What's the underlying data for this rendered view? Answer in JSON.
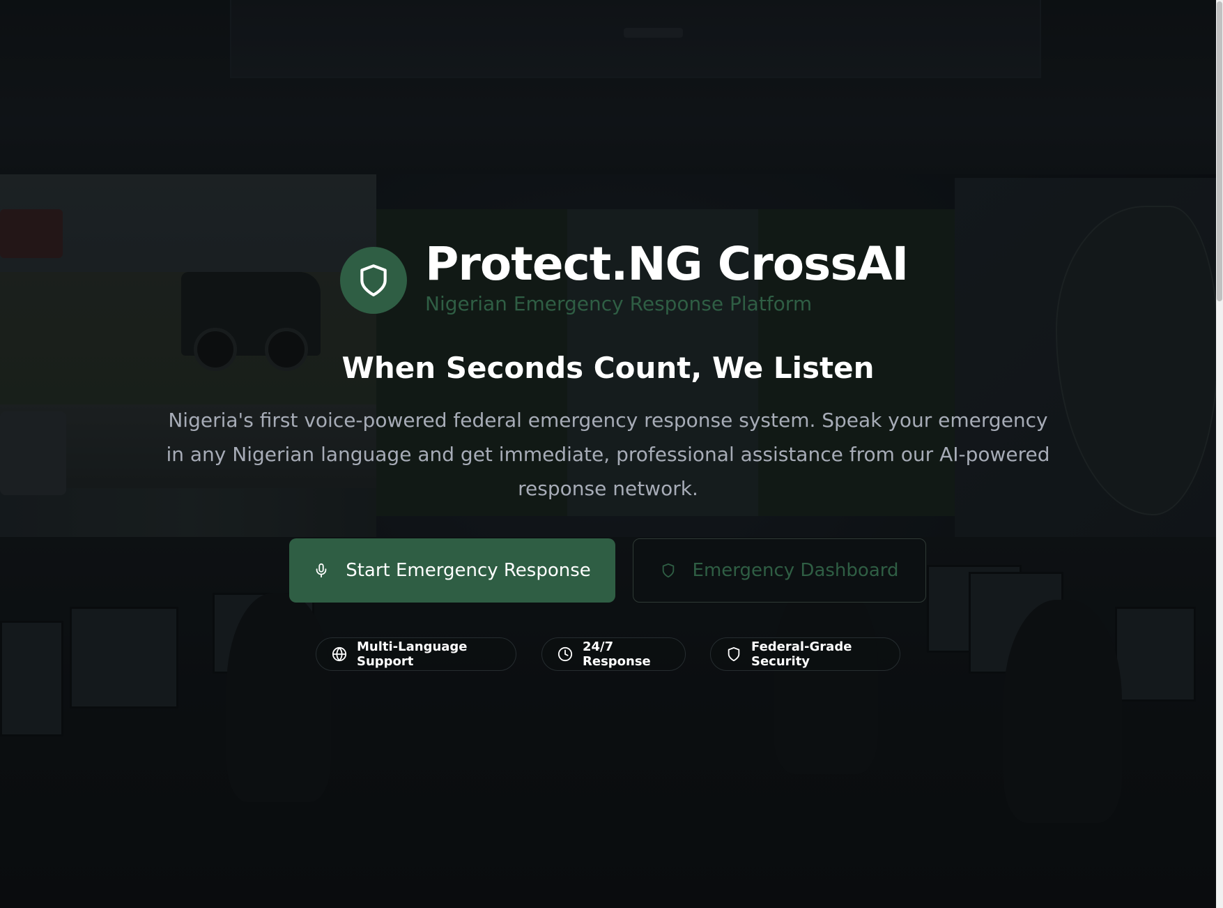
{
  "brand": {
    "title": "Protect.NG CrossAI",
    "subtitle": "Nigerian Emergency Response Platform",
    "logo_icon": "shield-icon"
  },
  "hero": {
    "headline": "When Seconds Count, We Listen",
    "description": "Nigeria's first voice-powered federal emergency response system. Speak your emergency in any Nigerian language and get immediate, professional assistance from our AI-powered response network."
  },
  "actions": {
    "primary": {
      "label": "Start Emergency Response",
      "icon": "microphone-icon"
    },
    "secondary": {
      "label": "Emergency Dashboard",
      "icon": "shield-icon"
    }
  },
  "features": [
    {
      "label": "Multi-Language Support",
      "icon": "globe-icon"
    },
    {
      "label": "24/7 Response",
      "icon": "clock-icon"
    },
    {
      "label": "Federal-Grade Security",
      "icon": "shield-icon"
    }
  ],
  "colors": {
    "brand_green": "#2f5e44",
    "text_muted": "#a7acb7",
    "background": "#0b0f12"
  }
}
